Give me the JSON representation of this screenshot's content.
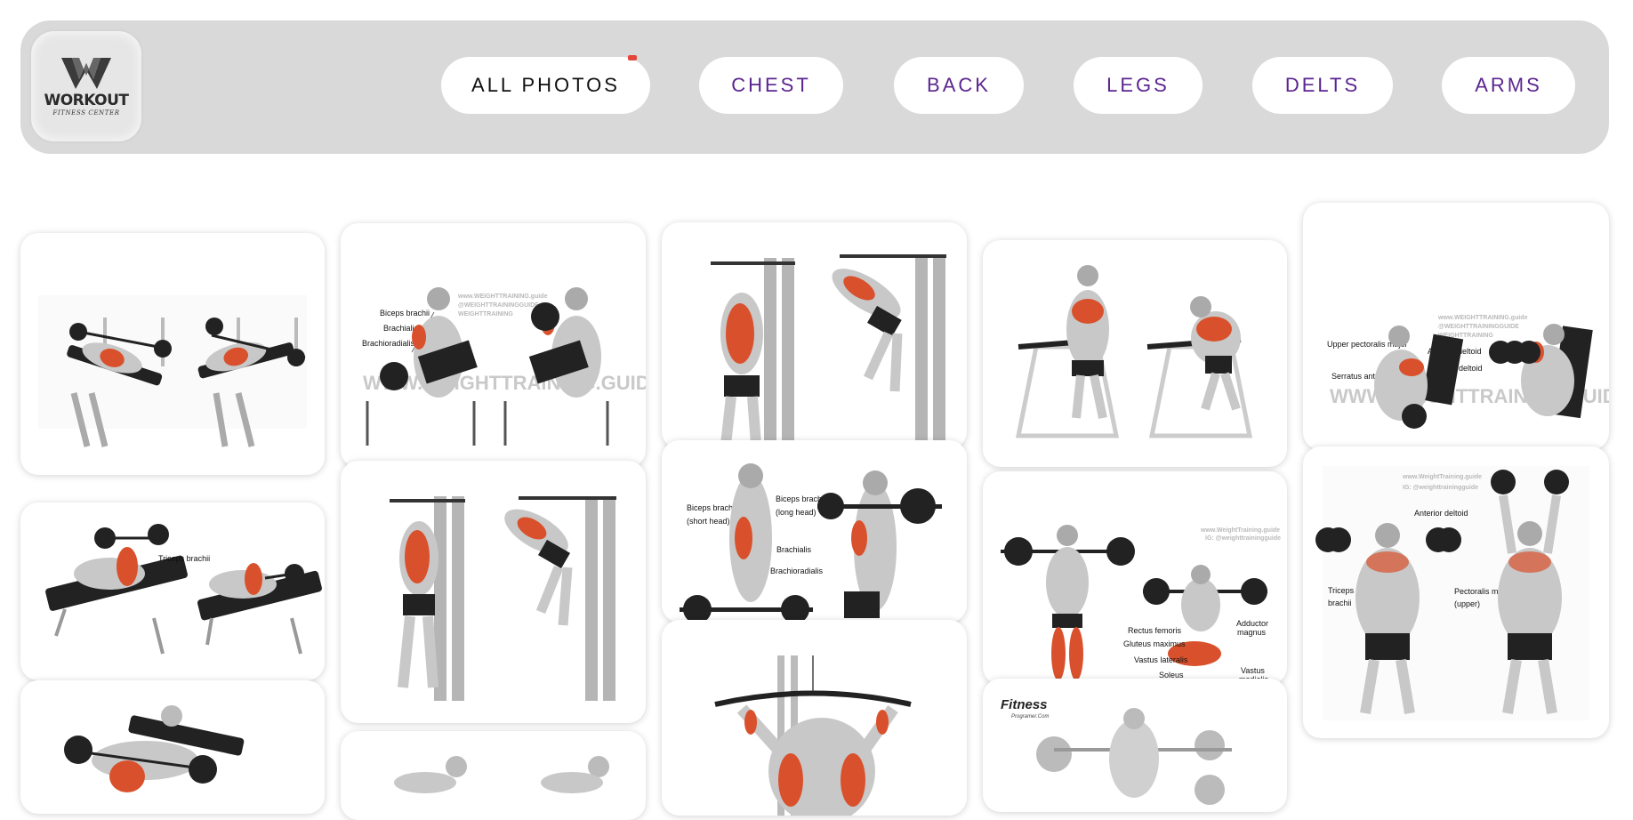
{
  "logo": {
    "word": "WORKOUT",
    "sub": "FITNESS CENTER"
  },
  "nav": {
    "items": [
      {
        "label": "ALL PHOTOS"
      },
      {
        "label": "CHEST"
      },
      {
        "label": "BACK"
      },
      {
        "label": "LEGS"
      },
      {
        "label": "DELTS"
      },
      {
        "label": "ARMS"
      }
    ]
  },
  "gallery": {
    "c2": {
      "labels": [
        "Biceps brachii",
        "Brachialis",
        "Brachioradialis"
      ],
      "wm_lines": [
        "www.WEIGHTTRAINING.guide",
        "@WEIGHTTRAININGGUIDE",
        "WEIGHTTRAINING"
      ],
      "wm_big": "WWW.WEIGHTTRAINING.GUIDE"
    },
    "c5": {
      "labels": [
        "Upper pectoralis major",
        "Anterior deltoid",
        "Lateral deltoid",
        "Serratus anterior"
      ],
      "wm_lines": [
        "www.WEIGHTTRAINING.guide",
        "@WEIGHTTRAININGGUIDE",
        "WEIGHTTRAINING"
      ],
      "wm_big": "WWW.WEIGHTTRAINING.GUIDE"
    },
    "c6": {
      "labels": [
        "Triceps brachii"
      ]
    },
    "c8": {
      "labels": [
        "Biceps brachii",
        "(short head)",
        "Biceps brachii",
        "(long head)",
        "Brachialis",
        "Brachioradialis"
      ]
    },
    "c9": {
      "wm_lines": [
        "www.WeightTraining.guide",
        "IG: @weighttrainingguide"
      ],
      "labels": [
        "Rectus femoris",
        "Gluteus maximus",
        "Vastus lateralis",
        "Soleus",
        "Adductor",
        "magnus",
        "Vastus",
        "medialis"
      ]
    },
    "c10": {
      "wm_lines": [
        "www.WeightTraining.guide",
        "IG: @weighttrainingguide"
      ],
      "labels": [
        "Anterior deltoid",
        "Triceps",
        "brachii",
        "Pectoralis major",
        "(upper)"
      ]
    },
    "c13": {
      "brand": "Fitness",
      "brand_sub": "Programer.Com"
    }
  },
  "colors": {
    "muscle": "#d9512c",
    "skin": "#cfcfcf",
    "purple": "#5b2590"
  }
}
